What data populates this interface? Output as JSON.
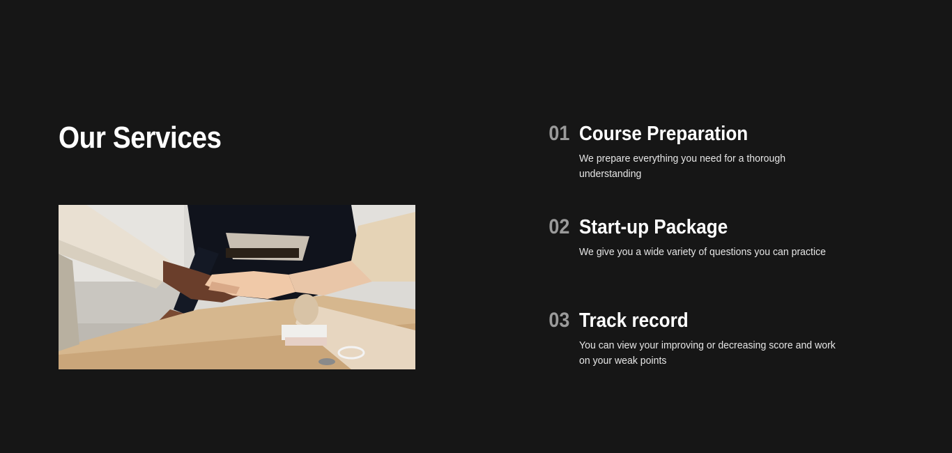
{
  "section": {
    "title": "Our Services",
    "image_subject": "handshake-photo"
  },
  "services": [
    {
      "number": "01",
      "title": "Course Preparation",
      "description": "We prepare everything you need for a thorough understanding"
    },
    {
      "number": "02",
      "title": "Start-up Package",
      "description": "We give you a wide variety of questions you can practice"
    },
    {
      "number": "03",
      "title": "Track record",
      "description": "You can view your improving or decreasing score and work on your weak points"
    }
  ],
  "colors": {
    "background": "#161616",
    "text": "#ffffff",
    "number": "#9a9a9a",
    "description": "#e6e6e6"
  }
}
